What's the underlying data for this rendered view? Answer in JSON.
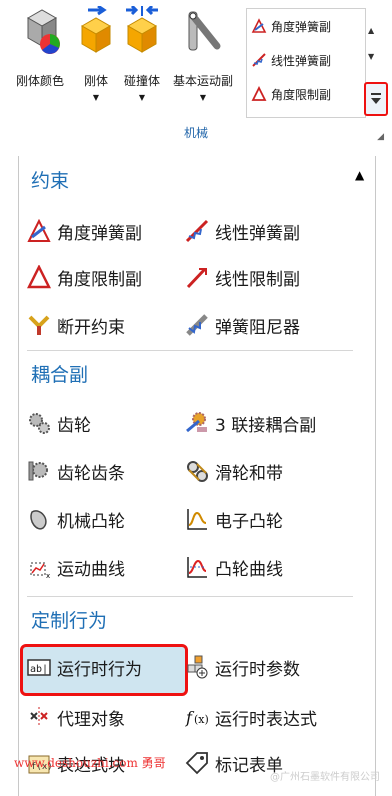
{
  "ribbon": {
    "buttons": [
      {
        "label": "刚体颜色",
        "icon": "rigid-body-color-icon"
      },
      {
        "label": "刚体",
        "icon": "rigid-body-icon"
      },
      {
        "label": "碰撞体",
        "icon": "collision-body-icon"
      },
      {
        "label": "基本运动副",
        "icon": "basic-joint-icon"
      }
    ],
    "gallery": [
      "角度弹簧副",
      "线性弹簧副",
      "角度限制副"
    ],
    "group_label": "机械"
  },
  "panel": {
    "sections": {
      "constraints": "约束",
      "couplers": "耦合副",
      "custom": "定制行为"
    },
    "items": {
      "angular_spring": "角度弹簧副",
      "linear_spring": "线性弹簧副",
      "angular_limit": "角度限制副",
      "linear_limit": "线性限制副",
      "breaking_constraint": "断开约束",
      "spring_damper": "弹簧阻尼器",
      "gear": "齿轮",
      "three_joint_coupler": "3 联接耦合副",
      "rack_pinion": "齿轮齿条",
      "pulley_belt": "滑轮和带",
      "mechanical_cam": "机械凸轮",
      "electronic_cam": "电子凸轮",
      "motion_profile": "运动曲线",
      "cam_profile": "凸轮曲线",
      "runtime_behavior": "运行时行为",
      "runtime_parameters": "运行时参数",
      "proxy_object": "代理对象",
      "runtime_expression": "运行时表达式",
      "expression_block": "表达式块",
      "marker_table": "标记表单"
    }
  },
  "watermark": {
    "left": "www.deshouzhi.com  勇哥",
    "right": "@广州石墨软件有限公司"
  },
  "colors": {
    "accent": "#1f6fb5",
    "highlight": "#e11111"
  }
}
